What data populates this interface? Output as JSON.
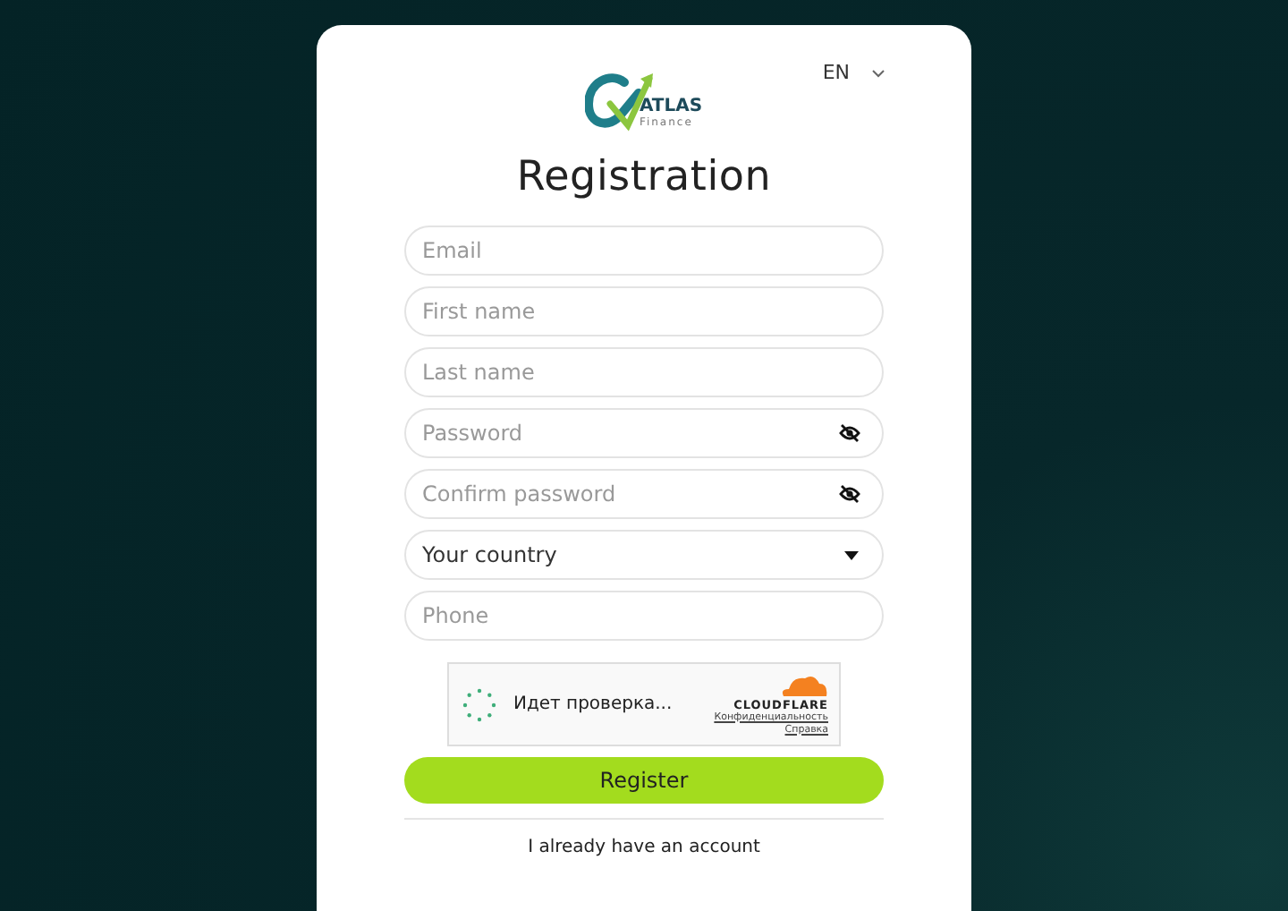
{
  "logo": {
    "name": "ATLAS",
    "tagline": "Finance"
  },
  "language": {
    "label": "EN"
  },
  "title": "Registration",
  "fields": [
    {
      "kind": "text",
      "placeholder": "Email"
    },
    {
      "kind": "text",
      "placeholder": "First name"
    },
    {
      "kind": "text",
      "placeholder": "Last name"
    },
    {
      "kind": "password",
      "placeholder": "Password"
    },
    {
      "kind": "password",
      "placeholder": "Confirm password"
    },
    {
      "kind": "select",
      "value": "Your country"
    },
    {
      "kind": "text",
      "placeholder": "Phone"
    }
  ],
  "captcha": {
    "status": "Идет проверка...",
    "brand": "CLOUDFLARE",
    "links": [
      "Конфиденциальность",
      "Справка"
    ]
  },
  "register_button": "Register",
  "login_link": "I already have an account"
}
